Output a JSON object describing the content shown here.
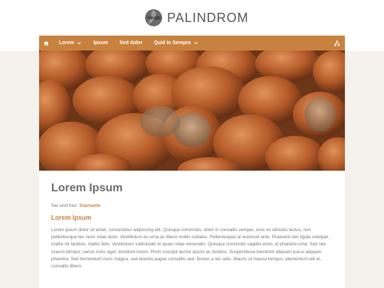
{
  "logo": {
    "text": "PALINDROM"
  },
  "nav": {
    "items": [
      {
        "label": "Lorem",
        "dropdown": true
      },
      {
        "label": "Ipsum",
        "dropdown": false
      },
      {
        "label": "Sed dolor",
        "dropdown": false
      },
      {
        "label": "Quid in Sempra",
        "dropdown": true
      }
    ],
    "home_icon": "home-icon",
    "right_icon": "sitemap-icon"
  },
  "hero": {
    "image": "hazelnuts-photo"
  },
  "main": {
    "title": "Lorem Ipsum",
    "breadcrumb_prefix": "Sie sind hier:",
    "breadcrumb_link": "Startseite",
    "subtitle": "Lorem Ipsum",
    "paragraph": "Lorem ipsum dolor sit amet, consectetur adipiscing elit. Quisque commodo, dolor in convallis semper, eros ex ultricies lectus, non pellentesque leo nunc vitae dolor. Vestibulum eu urna ac libero mollis sodales. Pellentesque ut euismod ante. Praesent nec ligula volutpat, mattis mi facilisis, mattis felis. Vestibulum sollicitudin in quam vitae venenatis. Quisque commodo sagittis enim, id pharetra urna. Sed nec mauris tempor, varius nunc eget, tincidunt lorem. Proin suscipit auctor ipsum ac facilisis. Suspendisse hendrerit aliquam purus aliquam pharetra. Sed fermentum nunc magna, sed laoreet augue convallis sed. Donec a leo odio. Mauris ut massa tempus, elementum elit et, convallis libero."
  },
  "colors": {
    "accent": "#c8823f",
    "background": "#f5f2ee",
    "text": "#777777"
  }
}
